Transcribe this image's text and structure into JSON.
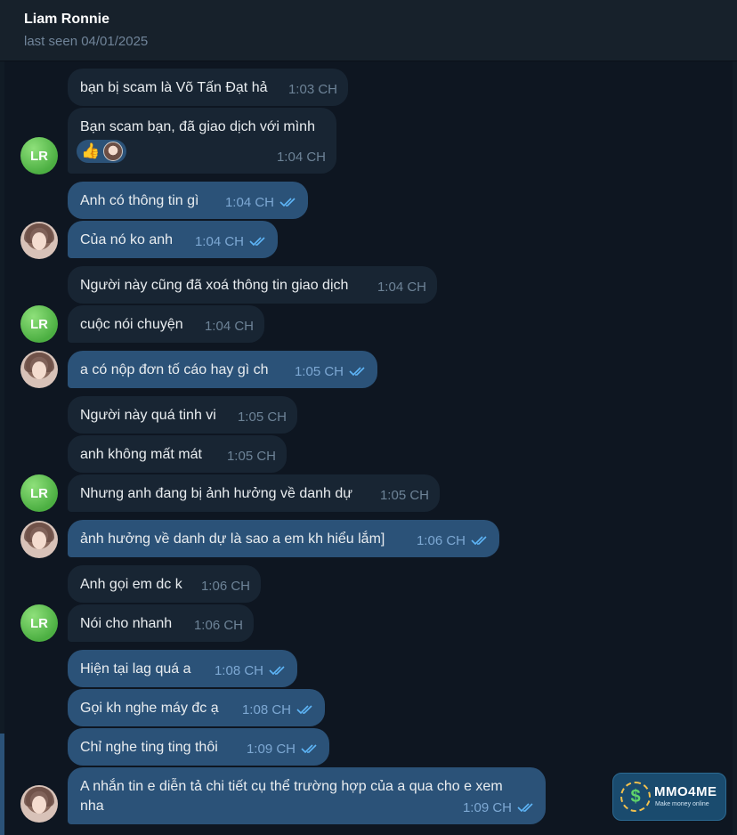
{
  "header": {
    "name": "Liam Ronnie",
    "status": "last seen 04/01/2025"
  },
  "contact_avatar_initials": "LR",
  "messages": [
    {
      "text": "bạn bị scam là Võ Tấn Đạt hả",
      "time": "1:03 CH",
      "direction": "in"
    },
    {
      "text": "Bạn scam bạn, đã giao dịch với mình",
      "time": "1:04 CH",
      "direction": "in",
      "reactions": [
        "thumbs-up",
        "user-avatar"
      ]
    },
    {
      "text": "Anh có thông tin gì",
      "time": "1:04 CH",
      "direction": "out",
      "read": true
    },
    {
      "text": "Của nó ko anh",
      "time": "1:04 CH",
      "direction": "out",
      "read": true
    },
    {
      "text": "Người này cũng đã xoá thông tin giao dịch",
      "time": "1:04 CH",
      "direction": "in"
    },
    {
      "text": "cuộc nói chuyện",
      "time": "1:04 CH",
      "direction": "in"
    },
    {
      "text": "a có nộp đơn tố cáo hay gì ch",
      "time": "1:05 CH",
      "direction": "out",
      "read": true
    },
    {
      "text": "Người này quá tinh vi",
      "time": "1:05 CH",
      "direction": "in"
    },
    {
      "text": "anh không mất mát",
      "time": "1:05 CH",
      "direction": "in"
    },
    {
      "text": "Nhưng anh đang bị ảnh hưởng về danh dự",
      "time": "1:05 CH",
      "direction": "in"
    },
    {
      "text": "ảnh hưởng về danh dự là sao a em kh hiểu lắm]",
      "time": "1:06 CH",
      "direction": "out",
      "read": true
    },
    {
      "text": "Anh gọi em dc k",
      "time": "1:06 CH",
      "direction": "in"
    },
    {
      "text": "Nói cho nhanh",
      "time": "1:06 CH",
      "direction": "in"
    },
    {
      "text": "Hiện tại lag quá a",
      "time": "1:08 CH",
      "direction": "out",
      "read": true
    },
    {
      "text": "Gọi kh nghe máy đc ạ",
      "time": "1:08 CH",
      "direction": "out",
      "read": true
    },
    {
      "text": "Chỉ nghe ting ting thôi",
      "time": "1:09 CH",
      "direction": "out",
      "read": true
    },
    {
      "text": "A nhắn tin e diễn tả chi tiết cụ thể trường hợp của a qua cho e xem",
      "text_line2": "nha",
      "time": "1:09 CH",
      "direction": "out",
      "read": true
    }
  ],
  "watermark": {
    "brand": "MMO4ME",
    "tagline": "Make money online",
    "coin_symbol": "$"
  },
  "colors": {
    "background": "#0e1621",
    "header": "#17212b",
    "incoming_bubble": "#182533",
    "outgoing_bubble": "#2b5278",
    "read_check": "#5eb5f7",
    "avatar_green": "#4caf42"
  }
}
